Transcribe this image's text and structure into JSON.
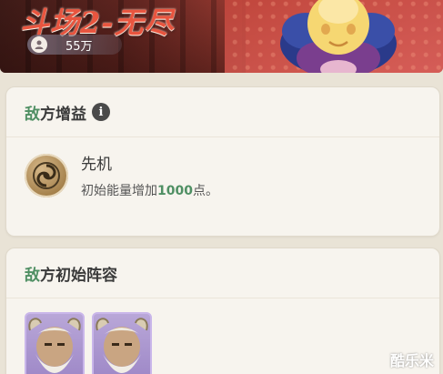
{
  "header": {
    "title": "斗场2-无尽",
    "reward_value": "55万",
    "reward_icon": "player-icon"
  },
  "enemy_buffs": {
    "title_accent": "敌",
    "title_rest": "方增益",
    "info_icon": "i",
    "buff": {
      "icon": "gear-swirl-icon",
      "name": "先机",
      "desc_before": "初始能量增加",
      "desc_number": "1000",
      "desc_after": "点。"
    }
  },
  "enemy_lineup": {
    "title_accent": "敌",
    "title_rest": "方初始阵容",
    "characters": [
      {
        "icon": "bearded-elder-portrait"
      },
      {
        "icon": "bearded-elder-portrait"
      }
    ]
  },
  "watermark": "酷乐米",
  "colors": {
    "accent_green": "#4f8f63",
    "title_red": "#e8553f",
    "card_bg": "#f7f4ee",
    "page_bg": "#e9e3d6",
    "char_frame": "#c9b6ea"
  }
}
